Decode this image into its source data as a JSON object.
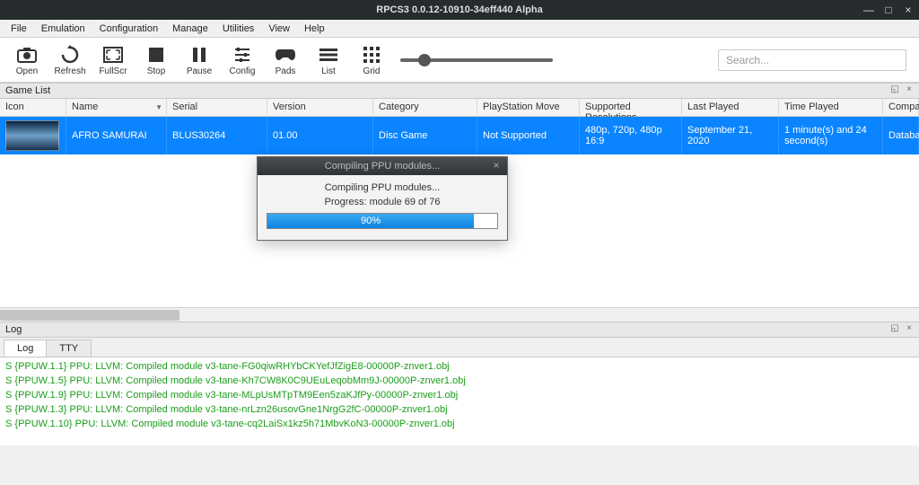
{
  "window": {
    "title": "RPCS3 0.0.12-10910-34eff440 Alpha"
  },
  "menus": [
    "File",
    "Emulation",
    "Configuration",
    "Manage",
    "Utilities",
    "View",
    "Help"
  ],
  "toolbar": {
    "items": [
      {
        "label": "Open",
        "icon": "camera"
      },
      {
        "label": "Refresh",
        "icon": "refresh"
      },
      {
        "label": "FullScr",
        "icon": "fullscreen"
      },
      {
        "label": "Stop",
        "icon": "stop"
      },
      {
        "label": "Pause",
        "icon": "pause"
      },
      {
        "label": "Config",
        "icon": "sliders"
      },
      {
        "label": "Pads",
        "icon": "gamepad"
      },
      {
        "label": "List",
        "icon": "list"
      },
      {
        "label": "Grid",
        "icon": "grid"
      }
    ],
    "search_placeholder": "Search..."
  },
  "gamelist": {
    "header": "Game List",
    "columns": [
      "Icon",
      "Name",
      "Serial",
      "Version",
      "Category",
      "PlayStation Move",
      "Supported Resolutions",
      "Last Played",
      "Time Played",
      "Compat"
    ],
    "sort_column": "Name",
    "rows": [
      {
        "name": "AFRO SAMURAI",
        "serial": "BLUS30264",
        "version": "01.00",
        "category": "Disc Game",
        "psmove": "Not Supported",
        "resolutions": "480p, 720p, 480p 16:9",
        "last_played": "September 21, 2020",
        "time_played": "1 minute(s) and 24 second(s)",
        "compat": "Databas"
      }
    ]
  },
  "dialog": {
    "title": "Compiling PPU modules...",
    "message": "Compiling PPU modules...",
    "progress_text": "Progress: module 69 of 76",
    "percent_label": "90%",
    "percent": 90
  },
  "log": {
    "header": "Log",
    "tabs": [
      "Log",
      "TTY"
    ],
    "active_tab": "Log",
    "lines": [
      "S {PPUW.1.1} PPU: LLVM: Compiled module v3-tane-FG0qiwRHYbCKYefJfZigE8-00000P-znver1.obj",
      "S {PPUW.1.5} PPU: LLVM: Compiled module v3-tane-Kh7CW8K0C9UEuLeqobMm9J-00000P-znver1.obj",
      "S {PPUW.1.9} PPU: LLVM: Compiled module v3-tane-MLpUsMTpTM9Een5zaKJfPy-00000P-znver1.obj",
      "S {PPUW.1.3} PPU: LLVM: Compiled module v3-tane-nrLzn26usovGne1NrgG2fC-00000P-znver1.obj",
      "S {PPUW.1.10} PPU: LLVM: Compiled module v3-tane-cq2LaiSx1kz5h71MbvKoN3-00000P-znver1.obj"
    ]
  }
}
